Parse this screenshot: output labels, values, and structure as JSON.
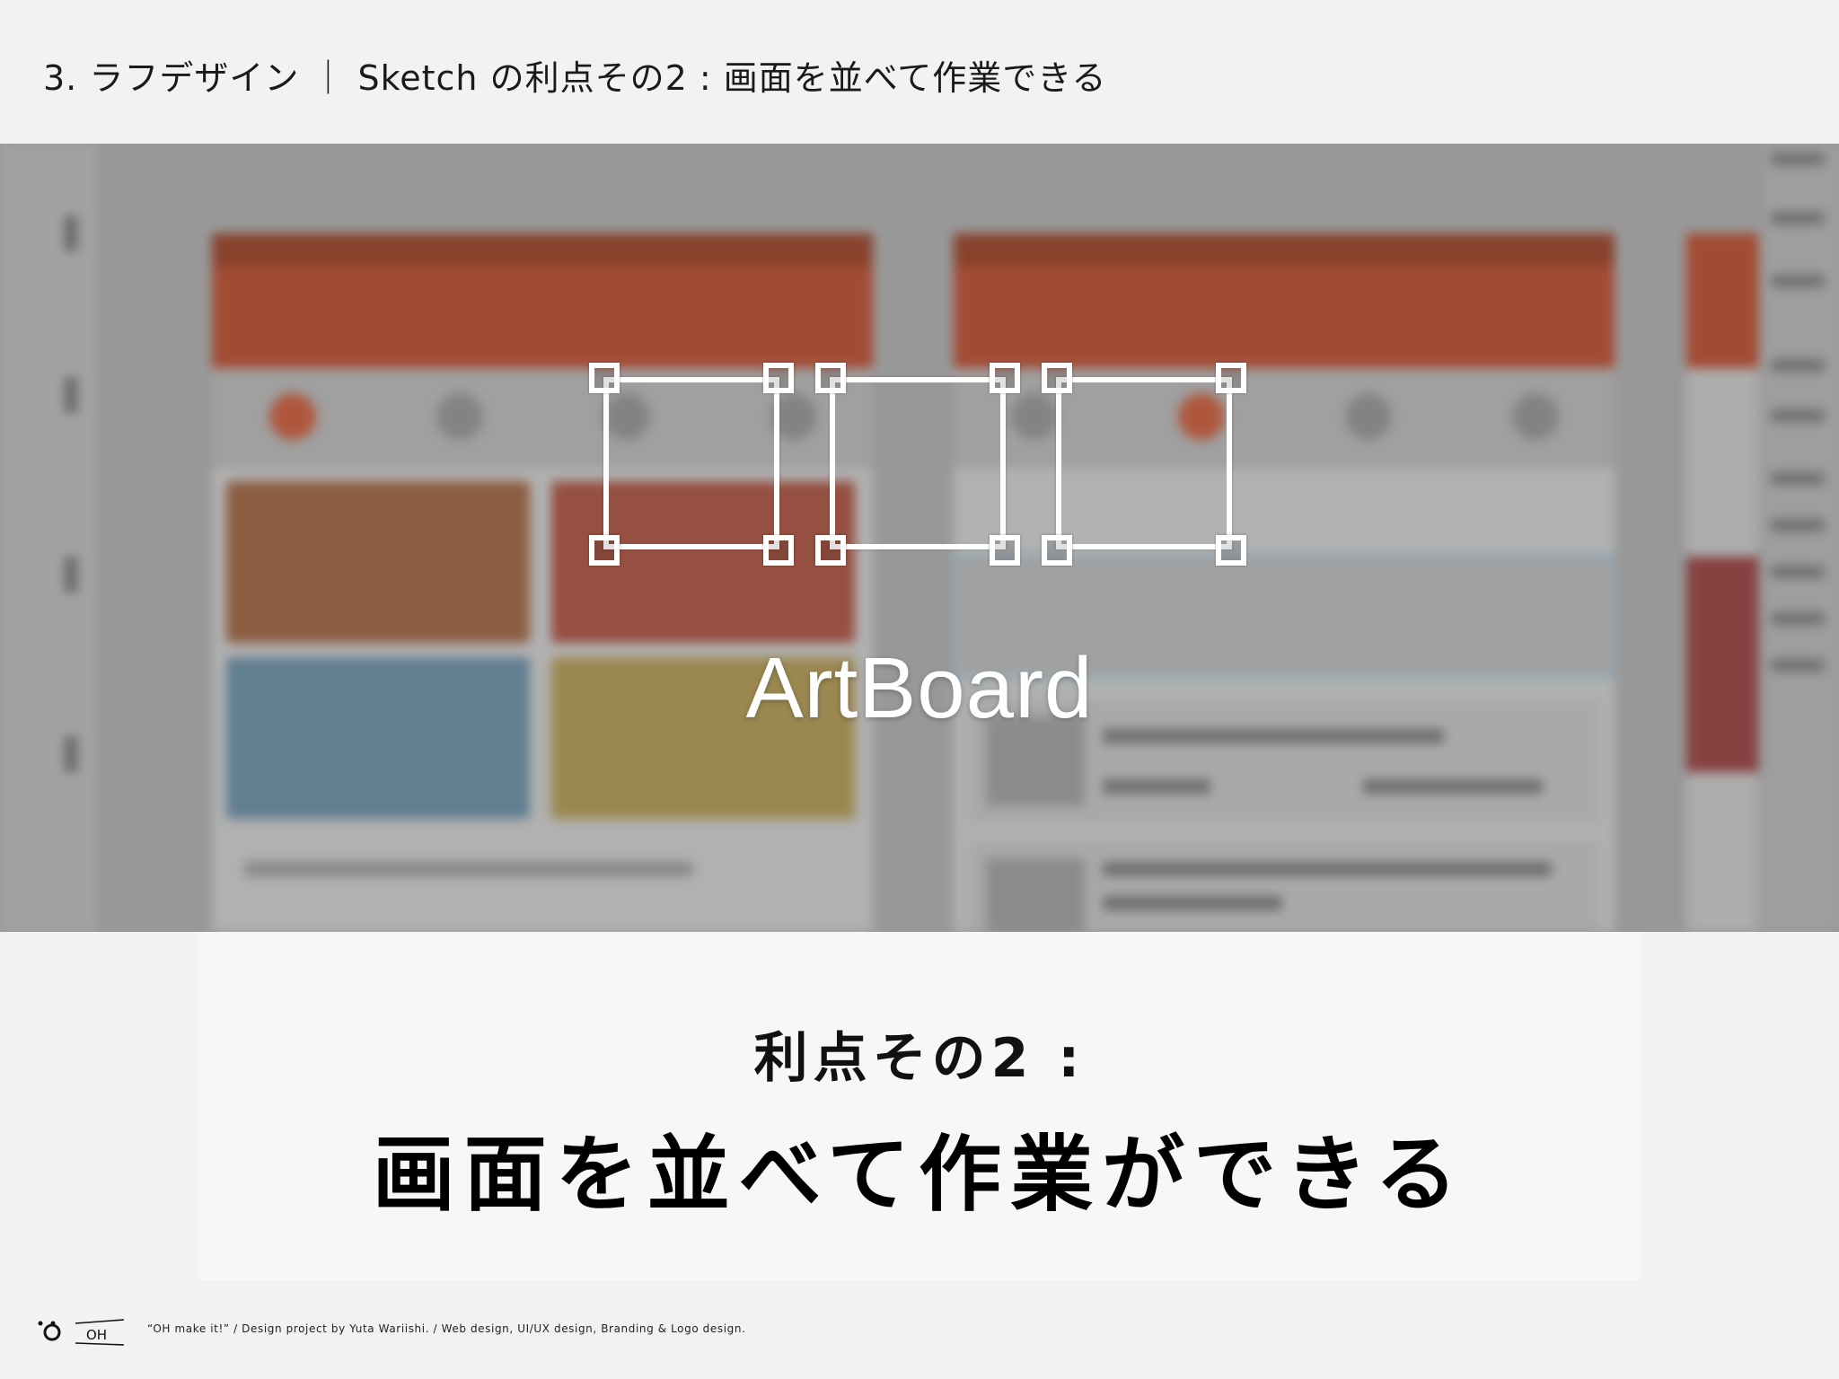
{
  "header": {
    "title": "3. ラフデザイン ｜ Sketch の利点その2 : 画面を並べて作業できる"
  },
  "illustration": {
    "artboard_label": "ArtBoard",
    "artboard_count": 3,
    "blurred_screens": [
      "app-screen-search",
      "app-screen-home",
      "app-screen-partial"
    ],
    "accent_color": "#a8452a",
    "frame_color": "#ffffff"
  },
  "caption": {
    "line1": "利点その2 :",
    "line2": "画面を並べて作業ができる"
  },
  "footer": {
    "logo_text": "OH",
    "credit": "“OH make it!”  /  Design project by Yuta Wariishi.  /  Web design, UI/UX design, Branding & Logo design."
  }
}
